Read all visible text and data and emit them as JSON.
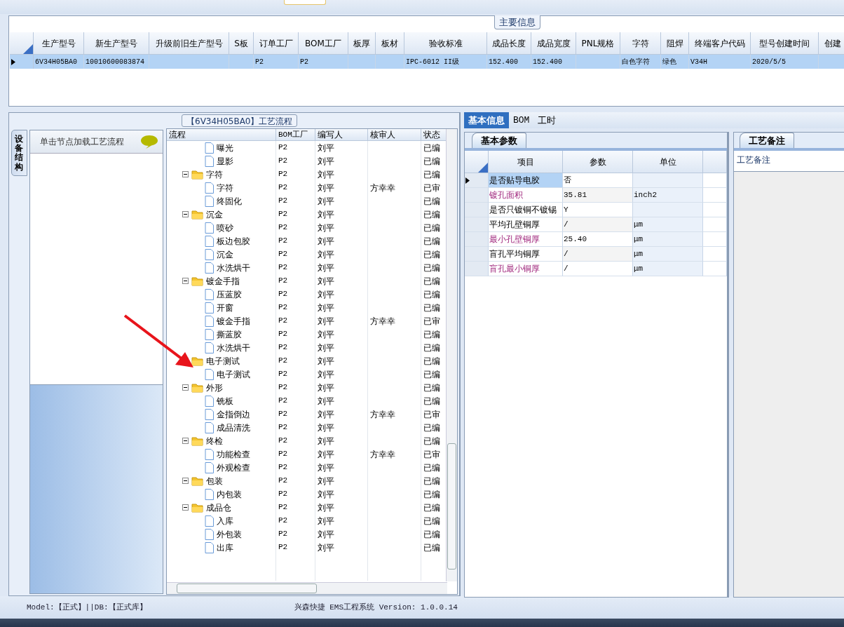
{
  "main_info": {
    "title": "主要信息",
    "columns": [
      "生产型号",
      "新生产型号",
      "升级前旧生产型号",
      "S板",
      "订单工厂",
      "BOM工厂",
      "板厚",
      "板材",
      "验收标准",
      "成品长度",
      "成品宽度",
      "PNL规格",
      "字符",
      "阻焊",
      "终端客户代码",
      "型号创建时间",
      "创建"
    ],
    "rows": [
      {
        "selected": true,
        "cells": [
          "6V34H05BA0",
          "10010600083874",
          null,
          null,
          "P2",
          "P2",
          null,
          null,
          "IPC-6012 II级",
          "152.400",
          "152.400",
          null,
          "白色字符",
          "绿色",
          "V34H",
          "2020/5/5",
          null
        ]
      }
    ]
  },
  "process_panel": {
    "title": "【6V34H05BA0】工艺流程",
    "side_tab": "设备结构",
    "hint": "单击节点加载工艺流程",
    "columns": [
      "流程",
      "BOM工厂",
      "编写人",
      "核审人",
      "状态"
    ],
    "tree": [
      {
        "children": [
          {
            "label": "曝光",
            "bom": "P2",
            "writer": "刘平",
            "status": "已编"
          },
          {
            "label": "显影",
            "bom": "P2",
            "writer": "刘平",
            "status": "已编"
          }
        ]
      },
      {
        "label": "字符",
        "bom": "P2",
        "writer": "刘平",
        "status": "已编",
        "expanded": true,
        "children": [
          {
            "label": "字符",
            "bom": "P2",
            "writer": "刘平",
            "reviewer": "方幸幸",
            "status": "已审"
          },
          {
            "label": "终固化",
            "bom": "P2",
            "writer": "刘平",
            "status": "已编"
          }
        ]
      },
      {
        "label": "沉金",
        "bom": "P2",
        "writer": "刘平",
        "status": "已编",
        "expanded": true,
        "children": [
          {
            "label": "喷砂",
            "bom": "P2",
            "writer": "刘平",
            "status": "已编"
          },
          {
            "label": "板边包胶",
            "bom": "P2",
            "writer": "刘平",
            "status": "已编"
          },
          {
            "label": "沉金",
            "bom": "P2",
            "writer": "刘平",
            "status": "已编"
          },
          {
            "label": "水洗烘干",
            "bom": "P2",
            "writer": "刘平",
            "status": "已编"
          }
        ]
      },
      {
        "label": "镀金手指",
        "bom": "P2",
        "writer": "刘平",
        "status": "已编",
        "expanded": true,
        "children": [
          {
            "label": "压蓝胶",
            "bom": "P2",
            "writer": "刘平",
            "status": "已编"
          },
          {
            "label": "开窗",
            "bom": "P2",
            "writer": "刘平",
            "status": "已编"
          },
          {
            "label": "镀金手指",
            "bom": "P2",
            "writer": "刘平",
            "reviewer": "方幸幸",
            "status": "已审"
          },
          {
            "label": "撕蓝胶",
            "bom": "P2",
            "writer": "刘平",
            "status": "已编"
          },
          {
            "label": "水洗烘干",
            "bom": "P2",
            "writer": "刘平",
            "status": "已编"
          }
        ]
      },
      {
        "label": "电子测试",
        "bom": "P2",
        "writer": "刘平",
        "status": "已编",
        "expanded": true,
        "children": [
          {
            "label": "电子测试",
            "bom": "P2",
            "writer": "刘平",
            "status": "已编"
          }
        ]
      },
      {
        "label": "外形",
        "bom": "P2",
        "writer": "刘平",
        "status": "已编",
        "expanded": true,
        "children": [
          {
            "label": "铣板",
            "bom": "P2",
            "writer": "刘平",
            "status": "已编"
          },
          {
            "label": "金指倒边",
            "bom": "P2",
            "writer": "刘平",
            "reviewer": "方幸幸",
            "status": "已审"
          },
          {
            "label": "成品清洗",
            "bom": "P2",
            "writer": "刘平",
            "status": "已编"
          }
        ]
      },
      {
        "label": "终检",
        "bom": "P2",
        "writer": "刘平",
        "status": "已编",
        "expanded": true,
        "children": [
          {
            "label": "功能检查",
            "bom": "P2",
            "writer": "刘平",
            "reviewer": "方幸幸",
            "status": "已审"
          },
          {
            "label": "外观检查",
            "bom": "P2",
            "writer": "刘平",
            "status": "已编"
          }
        ]
      },
      {
        "label": "包装",
        "bom": "P2",
        "writer": "刘平",
        "status": "已编",
        "expanded": true,
        "children": [
          {
            "label": "内包装",
            "bom": "P2",
            "writer": "刘平",
            "status": "已编"
          }
        ]
      },
      {
        "label": "成品仓",
        "bom": "P2",
        "writer": "刘平",
        "status": "已编",
        "expanded": true,
        "children": [
          {
            "label": "入库",
            "bom": "P2",
            "writer": "刘平",
            "status": "已编"
          },
          {
            "label": "外包装",
            "bom": "P2",
            "writer": "刘平",
            "status": "已编"
          },
          {
            "label": "出库",
            "bom": "P2",
            "writer": "刘平",
            "status": "已编"
          }
        ]
      }
    ]
  },
  "detail_tabs": [
    {
      "label": "基本信息",
      "selected": true
    },
    {
      "label": "BOM",
      "selected": false
    },
    {
      "label": "工时",
      "selected": false
    }
  ],
  "params": {
    "tab": "基本参数",
    "columns": [
      "项目",
      "参数",
      "单位"
    ],
    "rows": [
      {
        "item": "是否贴导电胶",
        "value": "否",
        "required": false,
        "selected": true
      },
      {
        "item": "镀孔面积",
        "value": "35.81",
        "unit": "inch2",
        "required": true,
        "selected": false
      },
      {
        "item": "是否只镀铜不镀锡",
        "value": "Y",
        "required": false,
        "selected": false
      },
      {
        "item": "平均孔壁铜厚",
        "value": "/",
        "unit": "μm",
        "required": false,
        "selected": false
      },
      {
        "item": "最小孔壁铜厚",
        "value": "25.40",
        "unit": "μm",
        "required": true,
        "selected": false
      },
      {
        "item": "盲孔平均铜厚",
        "value": "/",
        "unit": "μm",
        "required": false,
        "selected": false
      },
      {
        "item": "盲孔最小铜厚",
        "value": "/",
        "unit": "μm",
        "required": true,
        "selected": false
      }
    ]
  },
  "notes": {
    "tab": "工艺备注",
    "label": "工艺备注"
  },
  "status_bar": {
    "left": "Model:【正式】||DB:【正式库】",
    "center": "兴森快捷 EMS工程系统 Version: 1.0.0.14"
  }
}
